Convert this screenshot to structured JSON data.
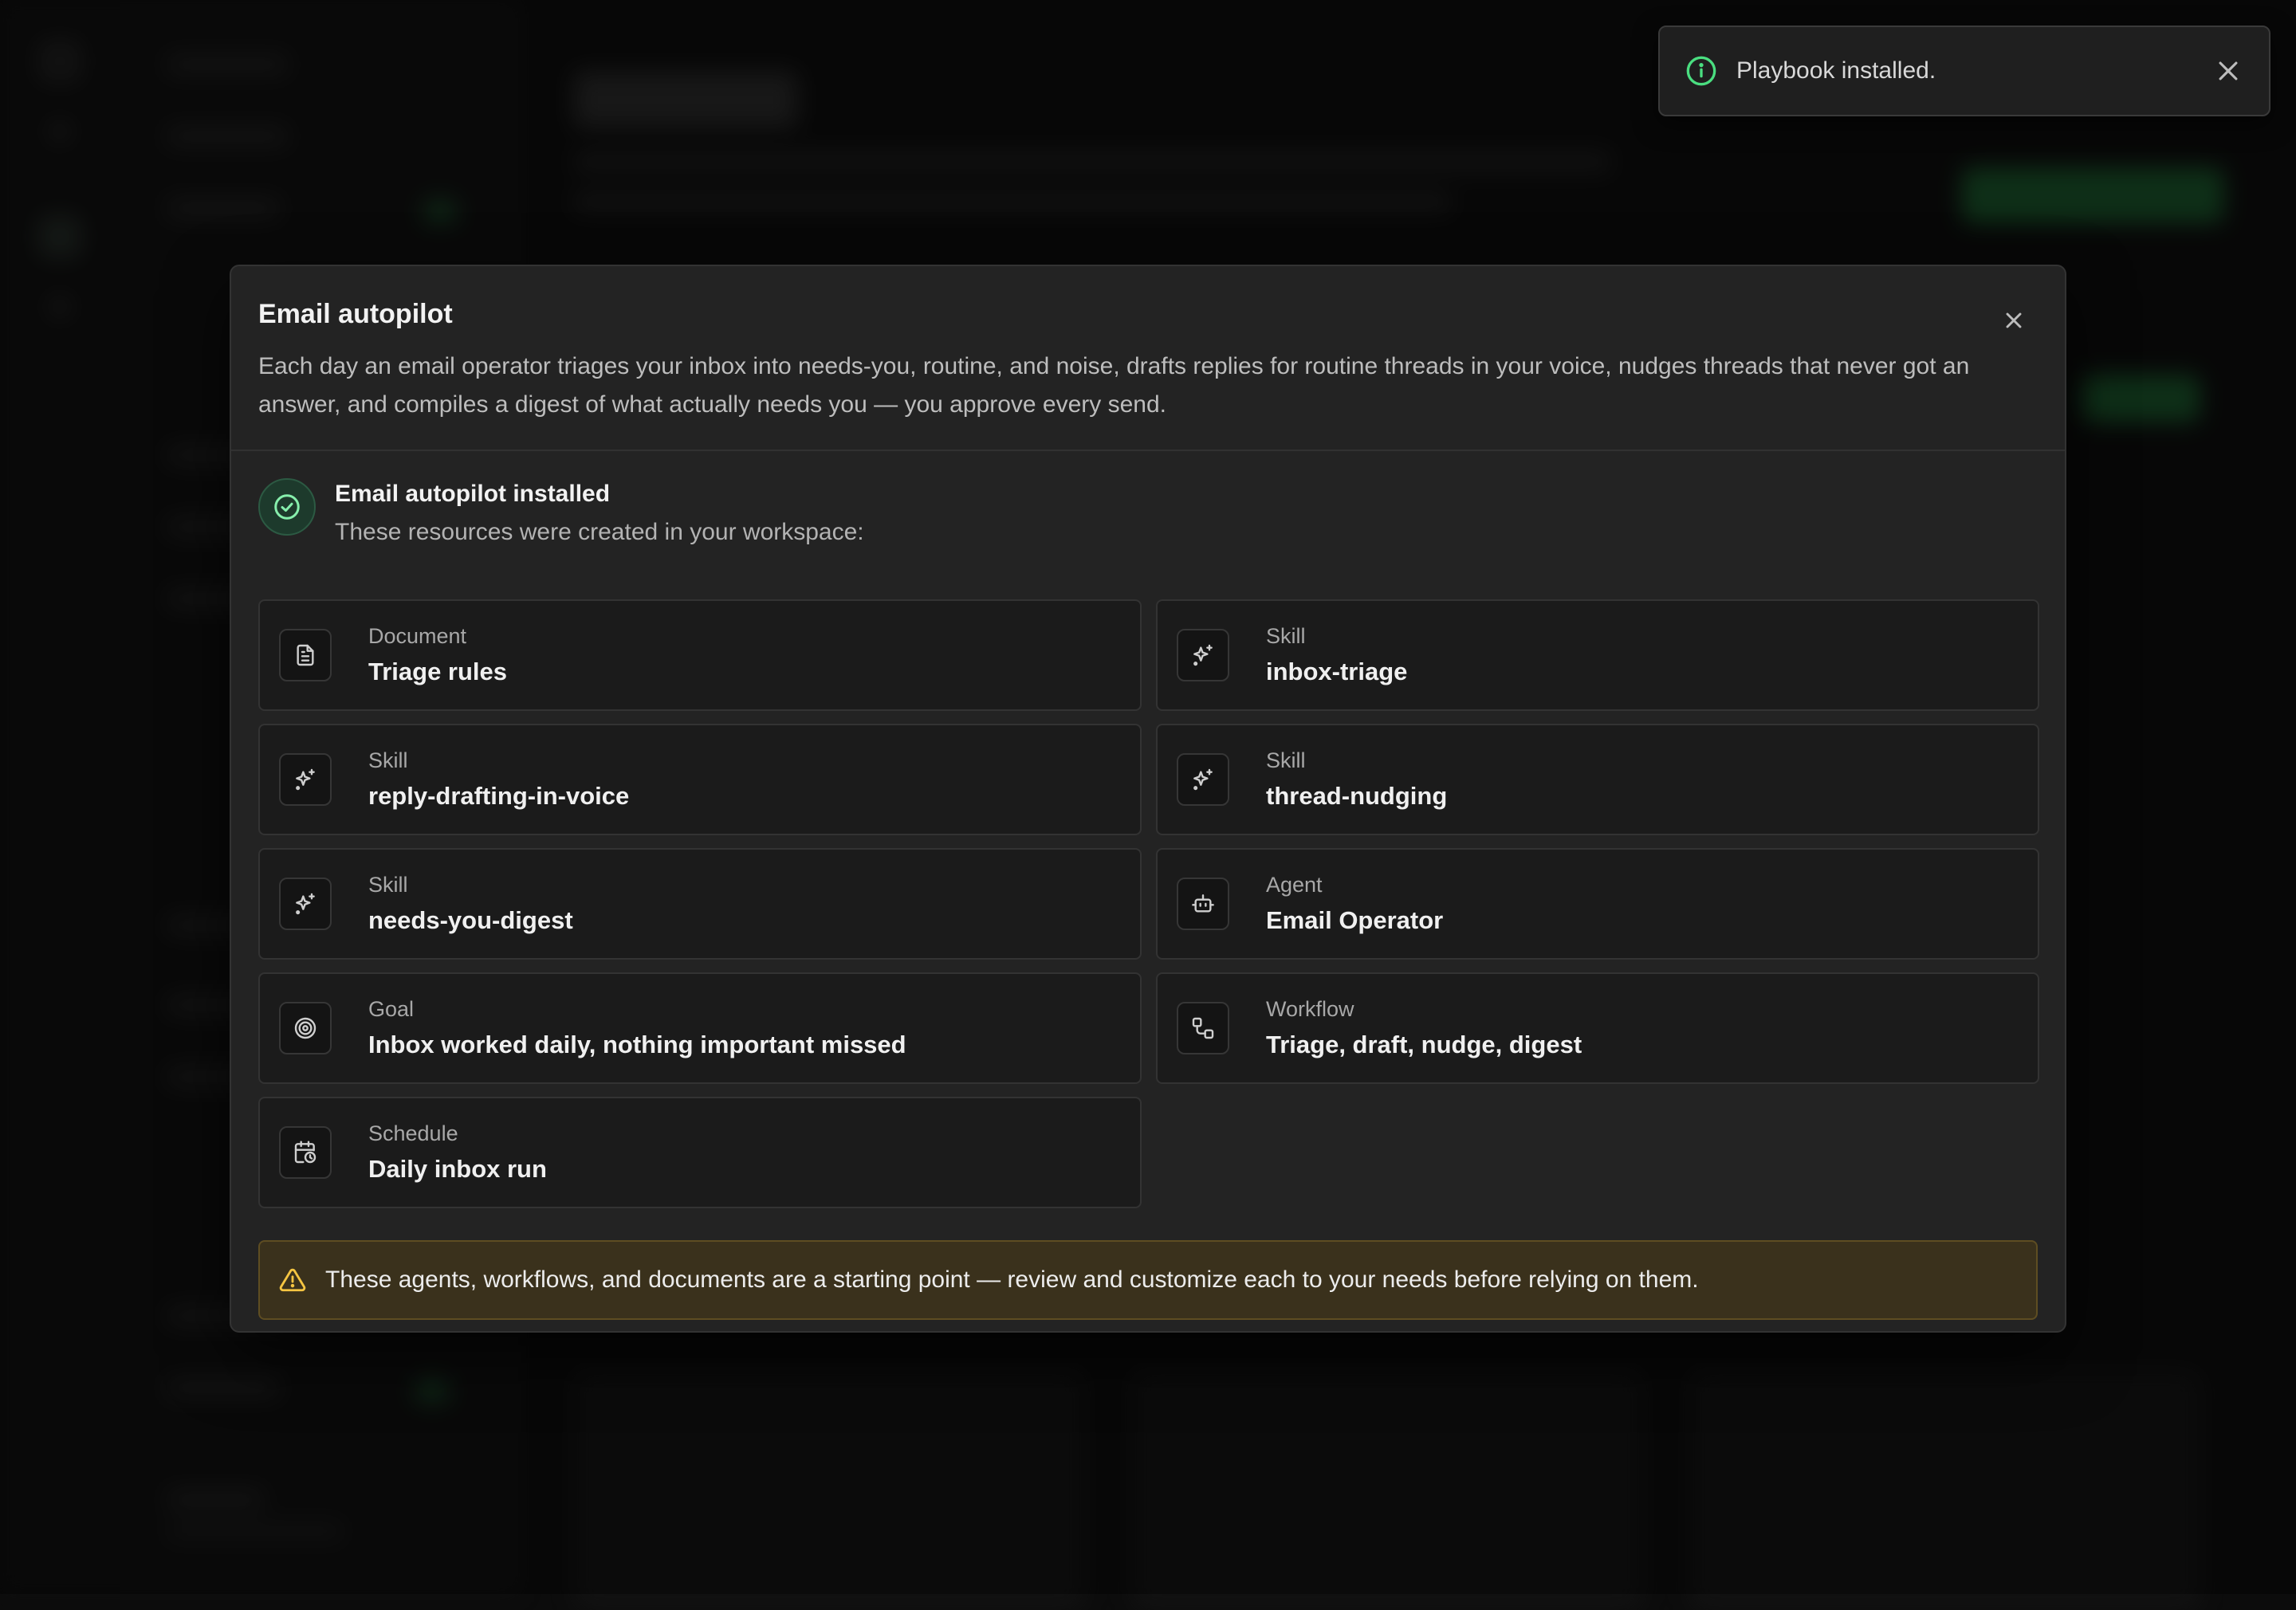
{
  "toast": {
    "message": "Playbook installed.",
    "info_icon": "info-icon",
    "close_icon": "close-icon"
  },
  "modal": {
    "title": "Email autopilot",
    "description": "Each day an email operator triages your inbox into needs-you, routine, and noise, drafts replies for routine threads in your voice, nudges threads that never got an answer, and compiles a digest of what actually needs you — you approve every send.",
    "success": {
      "title": "Email autopilot installed",
      "subtitle": "These resources were created in your workspace:"
    },
    "resources": [
      {
        "type": "Document",
        "name": "Triage rules",
        "icon": "document-icon"
      },
      {
        "type": "Skill",
        "name": "inbox-triage",
        "icon": "sparkles-icon"
      },
      {
        "type": "Skill",
        "name": "reply-drafting-in-voice",
        "icon": "sparkles-icon"
      },
      {
        "type": "Skill",
        "name": "thread-nudging",
        "icon": "sparkles-icon"
      },
      {
        "type": "Skill",
        "name": "needs-you-digest",
        "icon": "sparkles-icon"
      },
      {
        "type": "Agent",
        "name": "Email Operator",
        "icon": "bot-icon"
      },
      {
        "type": "Goal",
        "name": "Inbox worked daily, nothing important missed",
        "icon": "target-icon"
      },
      {
        "type": "Workflow",
        "name": "Triage, draft, nudge, digest",
        "icon": "workflow-icon"
      },
      {
        "type": "Schedule",
        "name": "Daily inbox run",
        "icon": "calendar-clock-icon"
      }
    ],
    "warning": "These agents, workflows, and documents are a starting point — review and customize each to your needs before relying on them."
  },
  "colors": {
    "accent_green": "#4ade80",
    "warning_yellow": "#f5c542",
    "modal_bg": "#232323"
  }
}
